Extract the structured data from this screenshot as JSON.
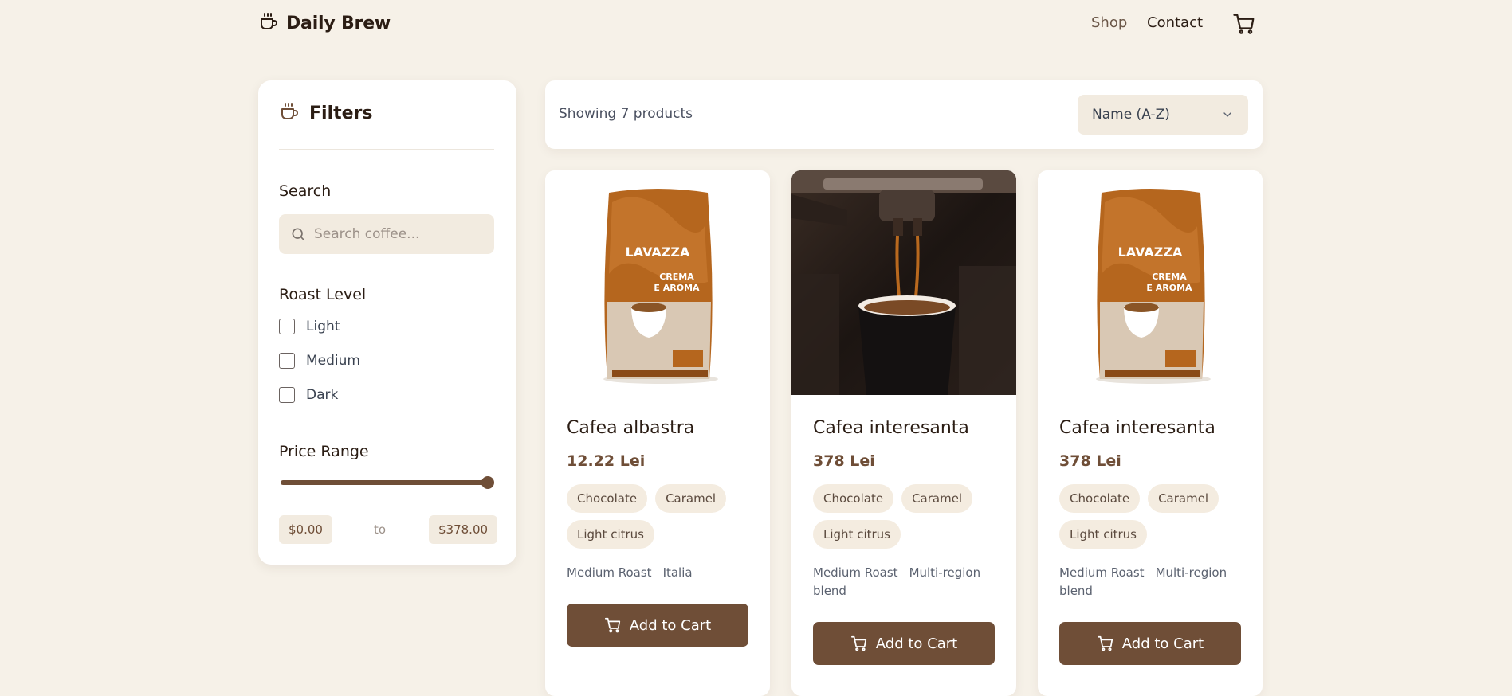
{
  "header": {
    "brand": "Daily Brew",
    "nav": {
      "shop": "Shop",
      "contact": "Contact"
    }
  },
  "sidebar": {
    "title": "Filters",
    "search": {
      "label": "Search",
      "placeholder": "Search coffee...",
      "value": ""
    },
    "roast": {
      "label": "Roast Level",
      "options": [
        {
          "label": "Light",
          "checked": false
        },
        {
          "label": "Medium",
          "checked": false
        },
        {
          "label": "Dark",
          "checked": false
        }
      ]
    },
    "price": {
      "label": "Price Range",
      "min": "$0.00",
      "to": "to",
      "max": "$378.00"
    }
  },
  "toolbar": {
    "showing": "Showing 7 products",
    "sort": "Name (A-Z)"
  },
  "products": [
    {
      "name": "Cafea albastra",
      "price": "12.22 Lei",
      "tags": [
        "Chocolate",
        "Caramel",
        "Light citrus"
      ],
      "roast": "Medium Roast",
      "origin": "Italia",
      "image": "coffee-bag",
      "cta": "Add to Cart"
    },
    {
      "name": "Cafea interesanta",
      "price": "378 Lei",
      "tags": [
        "Chocolate",
        "Caramel",
        "Light citrus"
      ],
      "roast": "Medium Roast",
      "origin": "Multi-region blend",
      "image": "espresso-pour",
      "cta": "Add to Cart"
    },
    {
      "name": "Cafea interesanta",
      "price": "378 Lei",
      "tags": [
        "Chocolate",
        "Caramel",
        "Light citrus"
      ],
      "roast": "Medium Roast",
      "origin": "Multi-region blend",
      "image": "coffee-bag",
      "cta": "Add to Cart"
    }
  ],
  "theme": {
    "accent": "#6f4e37",
    "background": "#f6f1e8",
    "chip": "#f2ebe0"
  }
}
